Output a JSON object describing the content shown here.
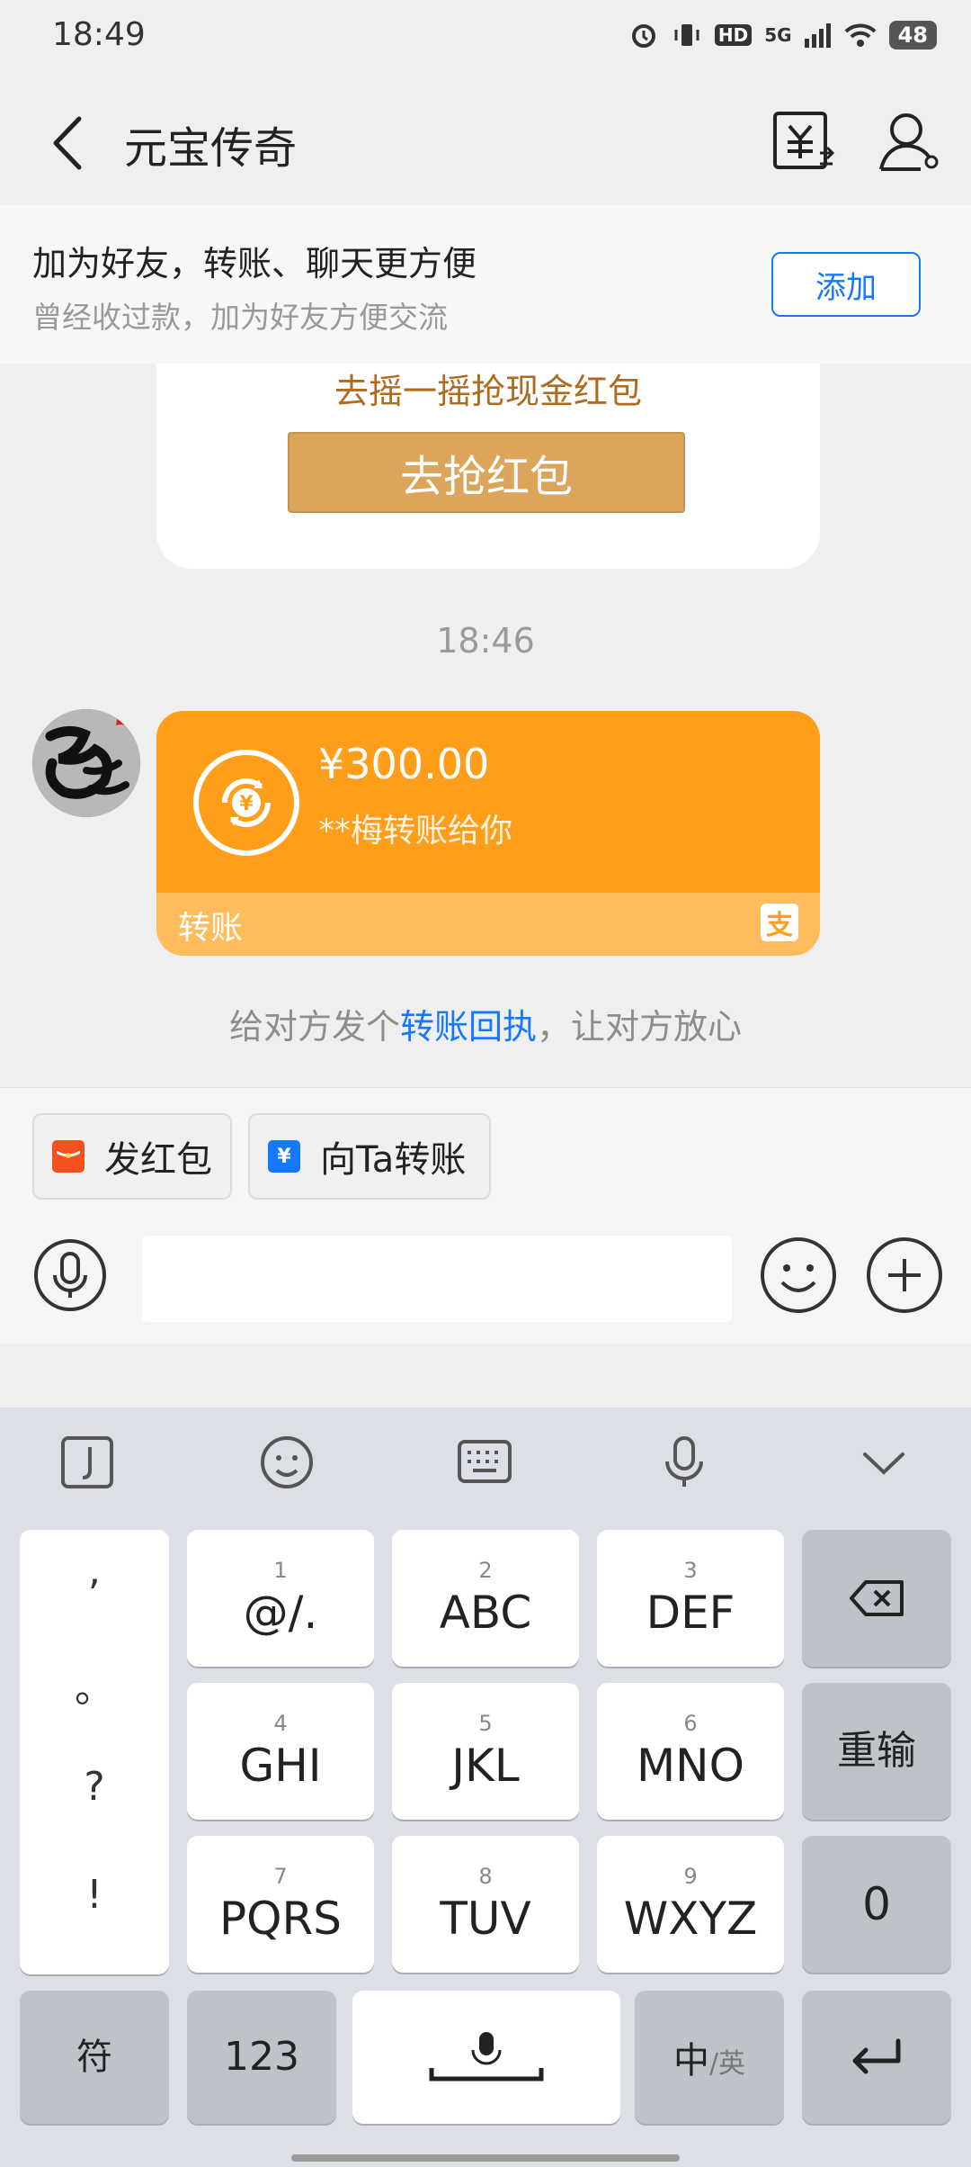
{
  "status_bar": {
    "time": "18:49",
    "network": "5G",
    "hd": "HD",
    "battery": "48"
  },
  "header": {
    "title": "元宝传奇"
  },
  "banner": {
    "title": "加为好友，转账、聊天更方便",
    "subtitle": "曾经收过款，加为好友方便交流",
    "add_label": "添加"
  },
  "red_packet": {
    "text": "去摇一摇抢现金红包",
    "button": "去抢红包"
  },
  "timestamp": "18:46",
  "transfer": {
    "amount": "¥300.00",
    "desc": "**梅转账给你",
    "label": "转账",
    "alipay_mark": "支"
  },
  "receipt": {
    "pre": "给对方发个",
    "link": "转账回执",
    "post": "，让对方放心"
  },
  "quick_actions": {
    "red_packet": "发红包",
    "transfer": "向Ta转账"
  },
  "keyboard": {
    "punct": [
      ",",
      "。",
      "?",
      "!"
    ],
    "keys": [
      {
        "num": "1",
        "letters": "@/."
      },
      {
        "num": "2",
        "letters": "ABC"
      },
      {
        "num": "3",
        "letters": "DEF"
      },
      {
        "num": "4",
        "letters": "GHI"
      },
      {
        "num": "5",
        "letters": "JKL"
      },
      {
        "num": "6",
        "letters": "MNO"
      },
      {
        "num": "7",
        "letters": "PQRS"
      },
      {
        "num": "8",
        "letters": "TUV"
      },
      {
        "num": "9",
        "letters": "WXYZ"
      }
    ],
    "reinput": "重输",
    "zero": "0",
    "symbol": "符",
    "num_mode": "123",
    "lang_main": "中",
    "lang_sub": "/英"
  },
  "colors": {
    "accent_blue": "#1677ff",
    "transfer_orange": "#ff9e1b",
    "red_packet_gold": "#dba65b"
  }
}
